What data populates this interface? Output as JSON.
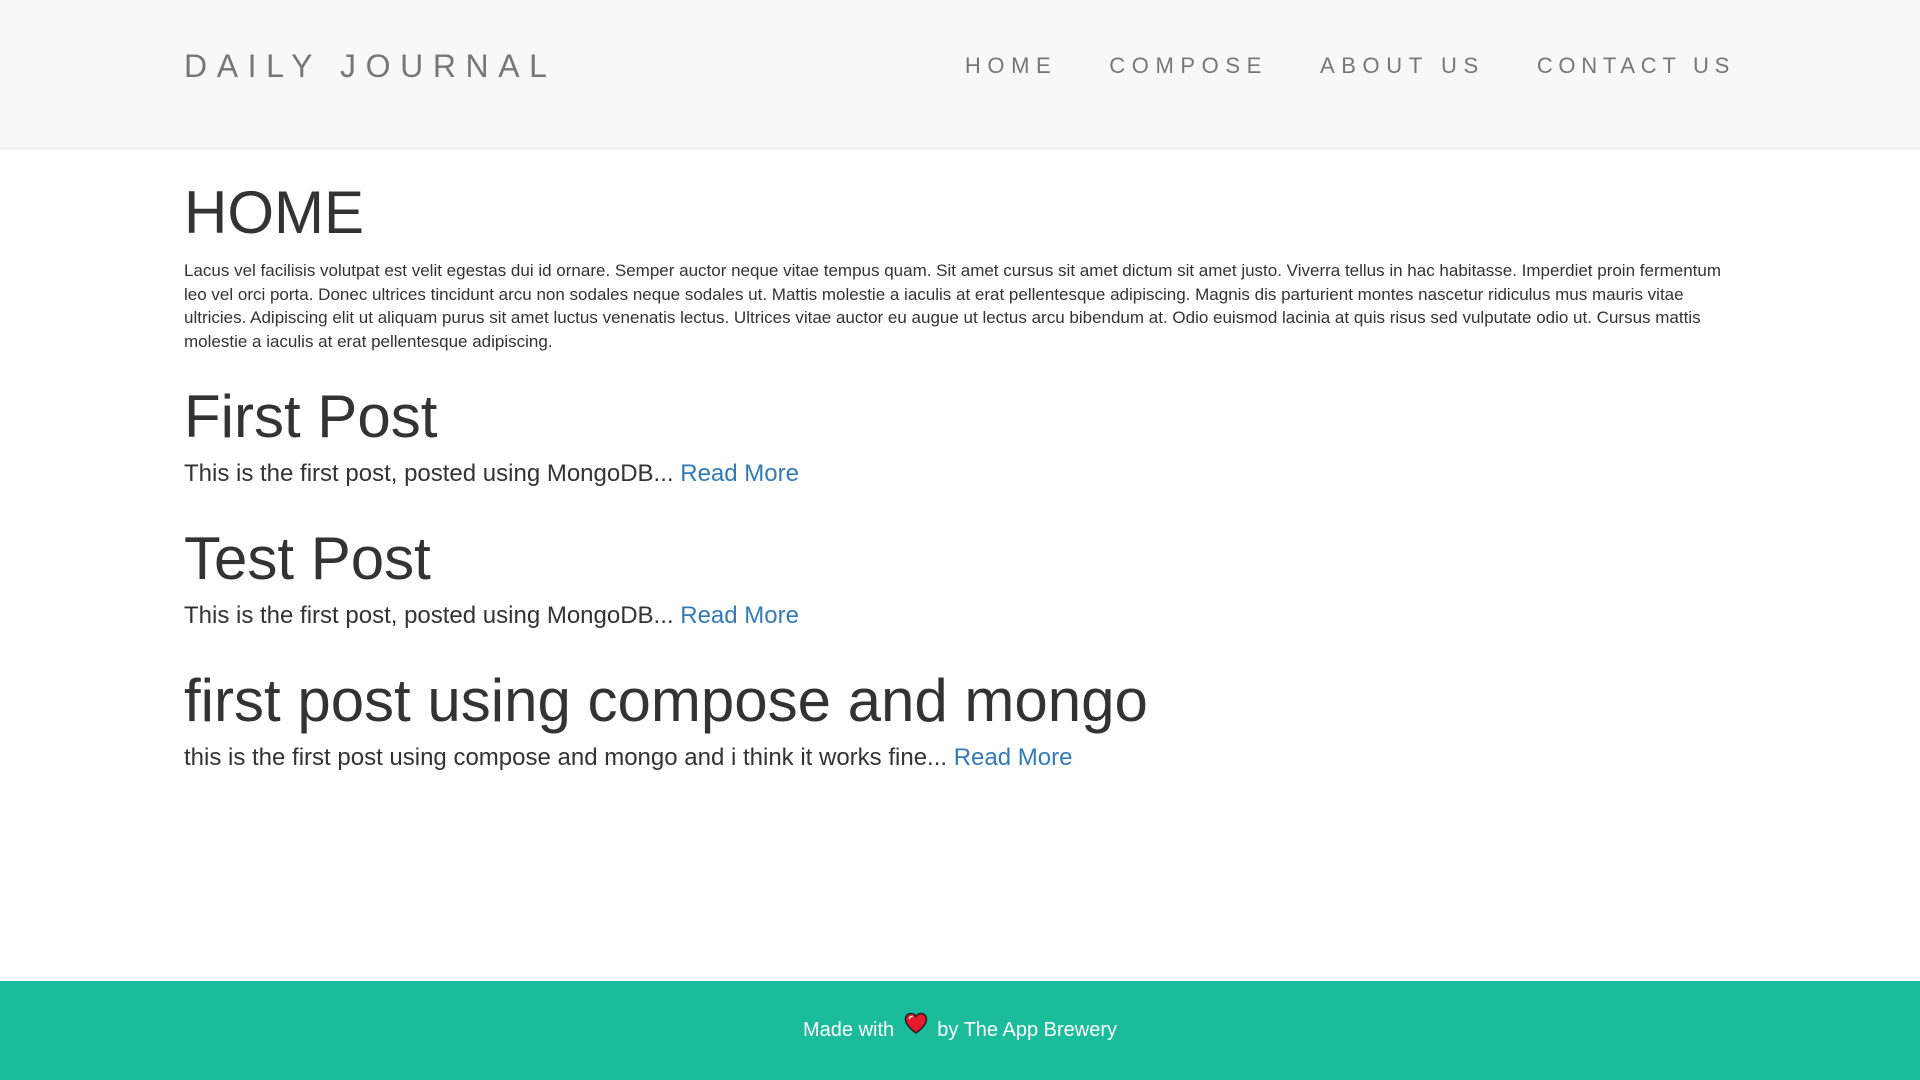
{
  "navbar": {
    "brand": "DAILY JOURNAL",
    "links": [
      "HOME",
      "COMPOSE",
      "ABOUT US",
      "CONTACT US"
    ]
  },
  "main": {
    "title": "HOME",
    "intro": "Lacus vel facilisis volutpat est velit egestas dui id ornare. Semper auctor neque vitae tempus quam. Sit amet cursus sit amet dictum sit amet justo. Viverra tellus in hac habitasse. Imperdiet proin fermentum leo vel orci porta. Donec ultrices tincidunt arcu non sodales neque sodales ut. Mattis molestie a iaculis at erat pellentesque adipiscing. Magnis dis parturient montes nascetur ridiculus mus mauris vitae ultricies. Adipiscing elit ut aliquam purus sit amet luctus venenatis lectus. Ultrices vitae auctor eu augue ut lectus arcu bibendum at. Odio euismod lacinia at quis risus sed vulputate odio ut. Cursus mattis molestie a iaculis at erat pellentesque adipiscing.",
    "posts": [
      {
        "title": "First Post",
        "excerpt": "This is the first post, posted using MongoDB...",
        "read_more": "Read More"
      },
      {
        "title": "Test Post",
        "excerpt": "This is the first post, posted using MongoDB...",
        "read_more": "Read More"
      },
      {
        "title": "first post using compose and mongo",
        "excerpt": "this is the first post using compose and mongo and i think it works fine...",
        "read_more": "Read More"
      }
    ]
  },
  "footer": {
    "text_before": "Made with",
    "icon": "heart-icon",
    "text_after": "by The App Brewery"
  },
  "colors": {
    "navbar_bg": "#f8f8f8",
    "nav_text": "#777777",
    "body_text": "#333333",
    "link": "#337ab7",
    "footer_bg": "#1abc9c",
    "heart": "#e8192c"
  }
}
